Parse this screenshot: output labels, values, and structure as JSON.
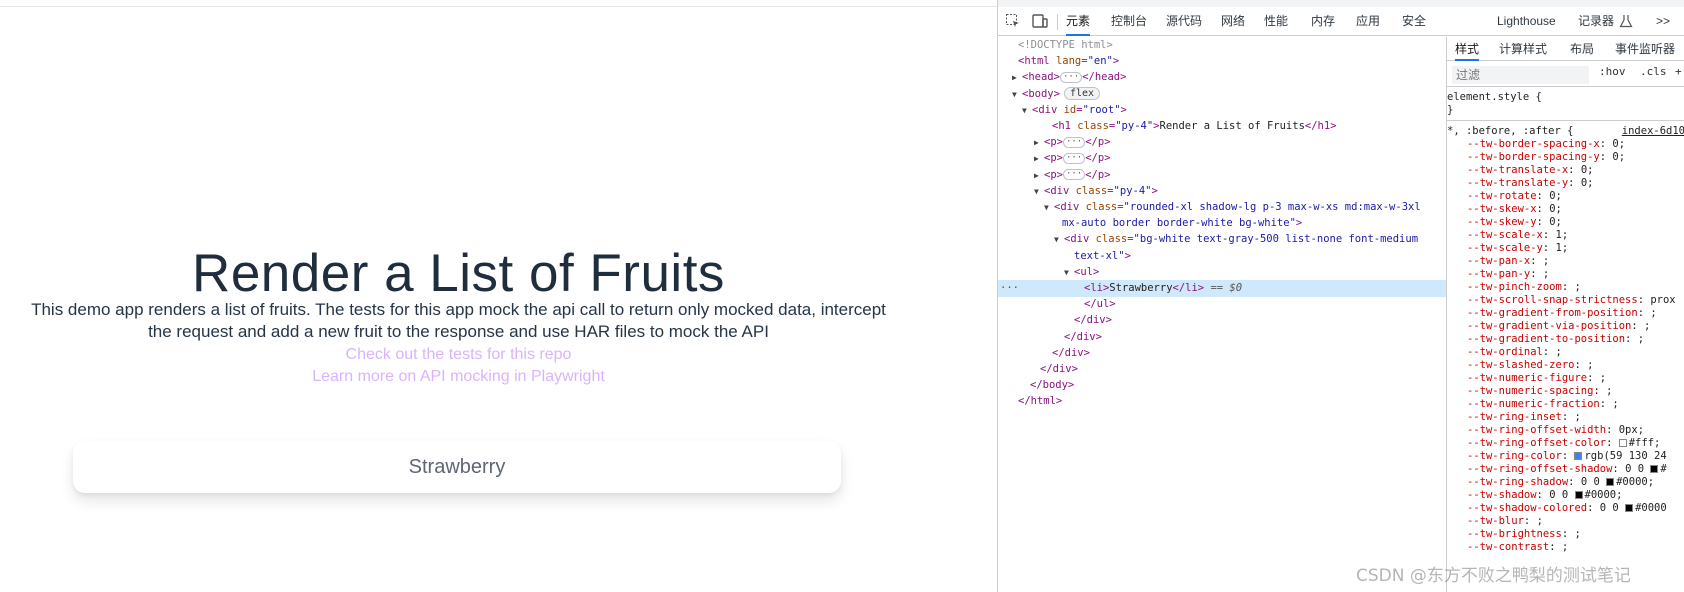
{
  "page": {
    "heading": "Render a List of Fruits",
    "description_line1": "This demo app renders a list of fruits. The tests for this app mock the api call to return only mocked data, intercept",
    "description_line2": "the request and add a new fruit to the response and use HAR files to mock the API",
    "link1": "Check out the tests for this repo",
    "link2": "Learn more on API mocking in Playwright",
    "fruits": [
      "Strawberry"
    ]
  },
  "devtools": {
    "tabs": [
      {
        "label": "元素",
        "active": true
      },
      {
        "label": "控制台"
      },
      {
        "label": "源代码"
      },
      {
        "label": "网络"
      },
      {
        "label": "性能"
      },
      {
        "label": "内存"
      },
      {
        "label": "应用"
      },
      {
        "label": "安全"
      },
      {
        "label": "Lighthouse"
      },
      {
        "label": "记录器"
      },
      {
        "label": ">>"
      }
    ],
    "icons": [
      "inspect-element-icon",
      "device-toolbar-icon",
      "recorder-flask-icon"
    ],
    "dom_lines": [
      {
        "t": "<!DOCTYPE html>",
        "cls": "cm"
      },
      {
        "t1": "<html ",
        "attr": "lang",
        "val": "\"en\"",
        "t2": ">"
      },
      {
        "tri": "▶",
        "t1": "<head>",
        "ell": "···",
        "t2": "</head>"
      },
      {
        "tri": "▼",
        "t1": "<body>",
        "pill": "flex"
      },
      {
        "tri": "▼",
        "t1": "<div ",
        "attr": "id",
        "val": "\"root\"",
        "t2": ">"
      },
      {
        "t1": "<h1 ",
        "attr": "class",
        "val": "\"py-4\"",
        "t2": ">",
        "text": "Render a List of Fruits",
        "t3": "</h1>"
      },
      {
        "tri": "▶",
        "t1": "<p>",
        "ell": "···",
        "t2": "</p>"
      },
      {
        "tri": "▶",
        "t1": "<p>",
        "ell": "···",
        "t2": "</p>"
      },
      {
        "tri": "▶",
        "t1": "<p>",
        "ell": "···",
        "t2": "</p>"
      },
      {
        "tri": "▼",
        "t1": "<div ",
        "attr": "class",
        "val": "\"py-4\"",
        "t2": ">"
      },
      {
        "tri": "▼",
        "t1": "<div ",
        "attr": "class",
        "val": "\"rounded-xl shadow-lg p-3 max-w-xs md:max-w-3xl"
      },
      {
        "val": "mx-auto border border-white bg-white\"",
        "t2": ">"
      },
      {
        "tri": "▼",
        "t1": "<div ",
        "attr": "class",
        "val": "\"bg-white text-gray-500 list-none font-medium"
      },
      {
        "val": "text-xl\"",
        "t2": ">"
      },
      {
        "tri": "▼",
        "t1": "<ul>"
      },
      {
        "t1": "<li>",
        "text": "Strawberry",
        "t3": "</li>",
        "eq": " == $0",
        "sel": true
      },
      {
        "t1": "</ul>"
      },
      {
        "t1": "</div>"
      },
      {
        "t1": "</div>"
      },
      {
        "t1": "</div>"
      },
      {
        "t1": "</div>"
      },
      {
        "t1": "</body>"
      },
      {
        "t1": "</html>"
      }
    ],
    "styles_tabs": [
      "样式",
      "计算样式",
      "布局",
      "事件监听器"
    ],
    "filter_placeholder": "过滤",
    "filter_tools": [
      ":hov",
      ".cls",
      "+"
    ],
    "element_style": "element.style {",
    "element_style_close": "}",
    "rule_selector": "*, :before, :after {",
    "rule_source": "index-6d10",
    "css_props": [
      {
        "p": "--tw-border-spacing-x",
        "v": "0;"
      },
      {
        "p": "--tw-border-spacing-y",
        "v": "0;"
      },
      {
        "p": "--tw-translate-x",
        "v": "0;"
      },
      {
        "p": "--tw-translate-y",
        "v": "0;"
      },
      {
        "p": "--tw-rotate",
        "v": "0;"
      },
      {
        "p": "--tw-skew-x",
        "v": "0;"
      },
      {
        "p": "--tw-skew-y",
        "v": "0;"
      },
      {
        "p": "--tw-scale-x",
        "v": "1;"
      },
      {
        "p": "--tw-scale-y",
        "v": "1;"
      },
      {
        "p": "--tw-pan-x",
        "v": ";"
      },
      {
        "p": "--tw-pan-y",
        "v": ";"
      },
      {
        "p": "--tw-pinch-zoom",
        "v": ";"
      },
      {
        "p": "--tw-scroll-snap-strictness",
        "v": "prox"
      },
      {
        "p": "--tw-gradient-from-position",
        "v": ";"
      },
      {
        "p": "--tw-gradient-via-position",
        "v": ";"
      },
      {
        "p": "--tw-gradient-to-position",
        "v": ";"
      },
      {
        "p": "--tw-ordinal",
        "v": ";"
      },
      {
        "p": "--tw-slashed-zero",
        "v": ";"
      },
      {
        "p": "--tw-numeric-figure",
        "v": ";"
      },
      {
        "p": "--tw-numeric-spacing",
        "v": ";"
      },
      {
        "p": "--tw-numeric-fraction",
        "v": ";"
      },
      {
        "p": "--tw-ring-inset",
        "v": ";"
      },
      {
        "p": "--tw-ring-offset-width",
        "v": "0px;"
      },
      {
        "p": "--tw-ring-offset-color",
        "v": "#fff;",
        "sw": "#ffffff"
      },
      {
        "p": "--tw-ring-color",
        "v": "rgb(59 130 24",
        "sw": "#3b82f6"
      },
      {
        "p": "--tw-ring-offset-shadow",
        "v": "0 0 ",
        "sw": "#000000",
        "v2": "#"
      },
      {
        "p": "--tw-ring-shadow",
        "v": "0 0 ",
        "sw": "#000000",
        "v2": "#0000;"
      },
      {
        "p": "--tw-shadow",
        "v": "0 0 ",
        "sw": "#000000",
        "v2": "#0000;"
      },
      {
        "p": "--tw-shadow-colored",
        "v": "0 0 ",
        "sw": "#000000",
        "v2": "#0000"
      },
      {
        "p": "--tw-blur",
        "v": ";"
      },
      {
        "p": "--tw-brightness",
        "v": ";"
      },
      {
        "p": "--tw-contrast",
        "v": ";"
      }
    ]
  },
  "watermark": "CSDN @东方不败之鸭梨的测试笔记",
  "colors": {
    "link": "#d8b4fe",
    "heading": "#1f2d3d",
    "tab_accent": "#1a73e8",
    "selection": "#cfe8fc"
  }
}
